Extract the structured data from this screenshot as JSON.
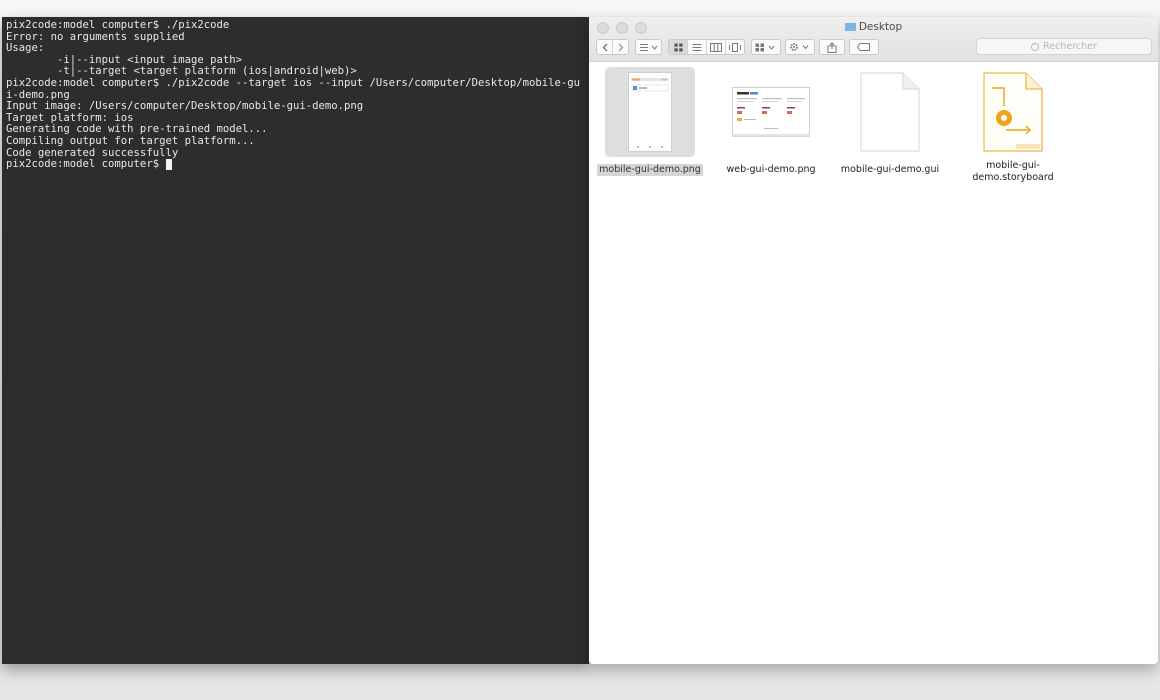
{
  "terminal": {
    "lines": [
      "pix2code:model computer$ ./pix2code",
      "Error: no arguments supplied",
      "Usage:",
      "        -i|--input <input image path>",
      "        -t|--target <target platform (ios|android|web)>",
      "pix2code:model computer$ ./pix2code --target ios --input /Users/computer/Desktop/mobile-gu",
      "i-demo.png",
      "Input image: /Users/computer/Desktop/mobile-gui-demo.png",
      "Target platform: ios",
      "Generating code with pre-trained model...",
      "Compiling output for target platform...",
      "Code generated successfully"
    ],
    "prompt": "pix2code:model computer$ "
  },
  "finder": {
    "title": "Desktop",
    "title_icon": "folder-icon",
    "toolbar": {
      "back_icon": "chevron-left-icon",
      "forward_icon": "chevron-right-icon",
      "arrange_icon": "arrange-icon",
      "views": [
        "icon-view",
        "list-view",
        "column-view",
        "cover-flow-view"
      ],
      "active_view": "icon-view",
      "group_icon": "group-icon",
      "action_icon": "gear-icon",
      "share_icon": "share-icon",
      "tag_icon": "tag-icon"
    },
    "search_placeholder": "Rechercher",
    "files": [
      {
        "name": "mobile-gui-demo.png",
        "kind": "mobile-screenshot",
        "selected": true
      },
      {
        "name": "web-gui-demo.png",
        "kind": "web-screenshot",
        "selected": false
      },
      {
        "name": "mobile-gui-demo.gui",
        "kind": "blank-document",
        "selected": false
      },
      {
        "name": "mobile-gui-\ndemo.storyboard",
        "kind": "storyboard-document",
        "selected": false
      }
    ]
  },
  "colors": {
    "terminal_bg": "#2d2d2d",
    "terminal_text": "#e8e8e8",
    "finder_bg": "#ffffff",
    "selection": "#d5d5d5",
    "storyboard_accent": "#f0a31c"
  }
}
